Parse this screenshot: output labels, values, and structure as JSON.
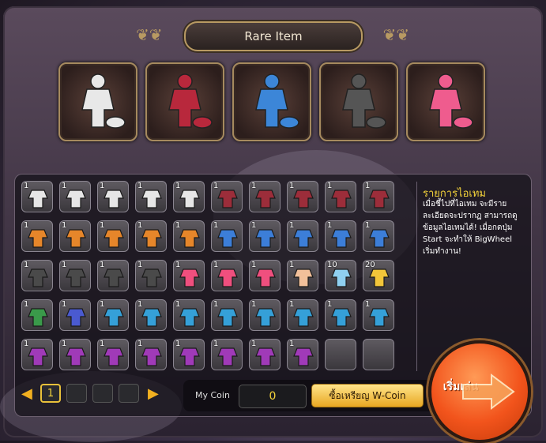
{
  "header": {
    "title": "Rare Item"
  },
  "rare_items": [
    {
      "name": "white-black outfit set icon",
      "color": "#e8e8e8"
    },
    {
      "name": "crimson outfit set icon",
      "color": "#b8283c"
    },
    {
      "name": "blue ninja outfit set icon",
      "color": "#3c86d8"
    },
    {
      "name": "dark grey outfit set icon",
      "color": "#555555"
    },
    {
      "name": "pink floral outfit set icon",
      "color": "#ef5c8e"
    }
  ],
  "inventory": {
    "rows": [
      [
        {
          "qty": "1",
          "color": "#e6e6e6"
        },
        {
          "qty": "1",
          "color": "#e6e6e6"
        },
        {
          "qty": "1",
          "color": "#e6e6e6"
        },
        {
          "qty": "1",
          "color": "#e6e6e6"
        },
        {
          "qty": "1",
          "color": "#e6e6e6"
        },
        {
          "qty": "1",
          "color": "#9c2d3a"
        },
        {
          "qty": "1",
          "color": "#9c2d3a"
        },
        {
          "qty": "1",
          "color": "#9c2d3a"
        },
        {
          "qty": "1",
          "color": "#9c2d3a"
        },
        {
          "qty": "1",
          "color": "#9c2d3a"
        }
      ],
      [
        {
          "qty": "1",
          "color": "#e6862a"
        },
        {
          "qty": "1",
          "color": "#e6862a"
        },
        {
          "qty": "1",
          "color": "#e6862a"
        },
        {
          "qty": "1",
          "color": "#e6862a"
        },
        {
          "qty": "1",
          "color": "#e6862a"
        },
        {
          "qty": "1",
          "color": "#3c7ed8"
        },
        {
          "qty": "1",
          "color": "#3c7ed8"
        },
        {
          "qty": "1",
          "color": "#3c7ed8"
        },
        {
          "qty": "1",
          "color": "#3c7ed8"
        },
        {
          "qty": "1",
          "color": "#3c7ed8"
        }
      ],
      [
        {
          "qty": "1",
          "color": "#4a4a4a"
        },
        {
          "qty": "1",
          "color": "#4a4a4a"
        },
        {
          "qty": "1",
          "color": "#4a4a4a"
        },
        {
          "qty": "1",
          "color": "#4a4a4a"
        },
        {
          "qty": "1",
          "color": "#ef4f7e"
        },
        {
          "qty": "1",
          "color": "#ef4f7e"
        },
        {
          "qty": "1",
          "color": "#ef4f7e"
        },
        {
          "qty": "1",
          "color": "#f2c09a"
        },
        {
          "qty": "10",
          "color": "#8fd0f0"
        },
        {
          "qty": "20",
          "color": "#f2c63a"
        }
      ],
      [
        {
          "qty": "1",
          "color": "#3a9a4a"
        },
        {
          "qty": "1",
          "color": "#4a5ad0"
        },
        {
          "qty": "1",
          "color": "#35a0d8"
        },
        {
          "qty": "1",
          "color": "#35a0d8"
        },
        {
          "qty": "1",
          "color": "#35a0d8"
        },
        {
          "qty": "1",
          "color": "#35a0d8"
        },
        {
          "qty": "1",
          "color": "#35a0d8"
        },
        {
          "qty": "1",
          "color": "#35a0d8"
        },
        {
          "qty": "1",
          "color": "#35a0d8"
        },
        {
          "qty": "1",
          "color": "#35a0d8"
        }
      ],
      [
        {
          "qty": "1",
          "color": "#a03ab8"
        },
        {
          "qty": "1",
          "color": "#a03ab8"
        },
        {
          "qty": "1",
          "color": "#a03ab8"
        },
        {
          "qty": "1",
          "color": "#a03ab8"
        },
        {
          "qty": "1",
          "color": "#a03ab8"
        },
        {
          "qty": "1",
          "color": "#a03ab8"
        },
        {
          "qty": "1",
          "color": "#a03ab8"
        },
        {
          "qty": "1",
          "color": "#a03ab8"
        },
        {
          "qty": "",
          "color": ""
        },
        {
          "qty": "",
          "color": ""
        }
      ]
    ]
  },
  "info": {
    "title": "รายการไอเทม",
    "text": "เมื่อชี้ไปที่ไอเทม จะมีรายละเอียดจะปรากฏ สามารถดูข้อมูลไอเทมได้! เมื่อกดปุ่ม Start จะทำให้ BigWheel เริ่มทำงาน!"
  },
  "pager": {
    "current": "1",
    "prev_icon": "chevron-left-icon",
    "next_icon": "chevron-right-icon"
  },
  "coin": {
    "label": "My Coin",
    "value": "0",
    "buy_label": "ซื้อเหรียญ W-Coin"
  },
  "start": {
    "label": "เริ่มเล่น",
    "icon": "arrow-right-icon"
  },
  "colors": {
    "accent": "#f3d23a",
    "start_button": "#f2541c",
    "frame_gold": "#b89a62"
  }
}
